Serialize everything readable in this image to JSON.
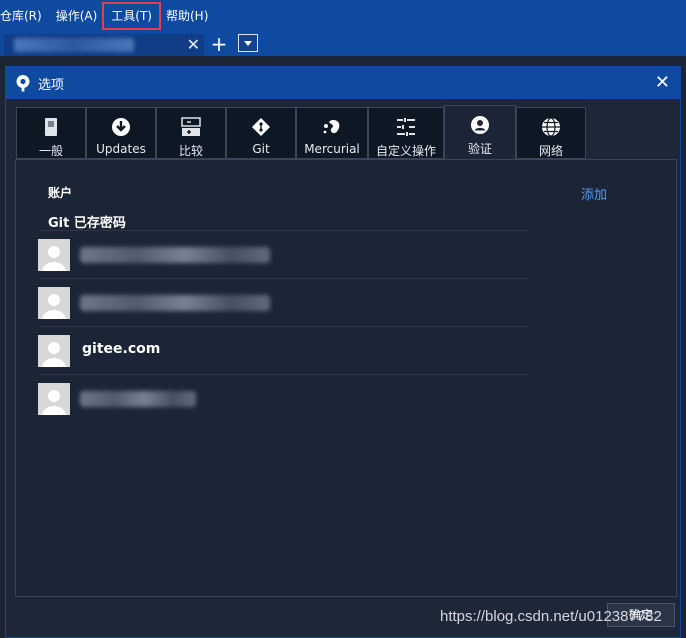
{
  "menubar": {
    "items": [
      "仓库(R)",
      "操作(A)",
      "工具(T)",
      "帮助(H)"
    ],
    "highlighted_index": 2
  },
  "dialog": {
    "title": "选项",
    "close_glyph": "✕",
    "tabs": [
      {
        "label": "一般",
        "icon": "switch-icon"
      },
      {
        "label": "Updates",
        "icon": "download-icon"
      },
      {
        "label": "比较",
        "icon": "compare-icon"
      },
      {
        "label": "Git",
        "icon": "git-icon"
      },
      {
        "label": "Mercurial",
        "icon": "mercurial-icon"
      },
      {
        "label": "自定义操作",
        "icon": "custom-actions-icon"
      },
      {
        "label": "验证",
        "icon": "user-icon"
      },
      {
        "label": "网络",
        "icon": "globe-icon"
      }
    ],
    "active_tab_index": 6,
    "accounts_heading": "账户",
    "add_label": "添加",
    "git_saved_heading": "Git 已存密码",
    "credentials": [
      {
        "name": "",
        "blurred": true
      },
      {
        "name": "",
        "blurred": true
      },
      {
        "name": "gitee.com",
        "blurred": false
      },
      {
        "name": "",
        "blurred": true
      }
    ],
    "ok_label": "确定"
  },
  "watermark": "https://blog.csdn.net/u012387782",
  "colors": {
    "accent": "#0f4aa1",
    "link": "#4a9eff",
    "highlight": "#e0424b"
  }
}
